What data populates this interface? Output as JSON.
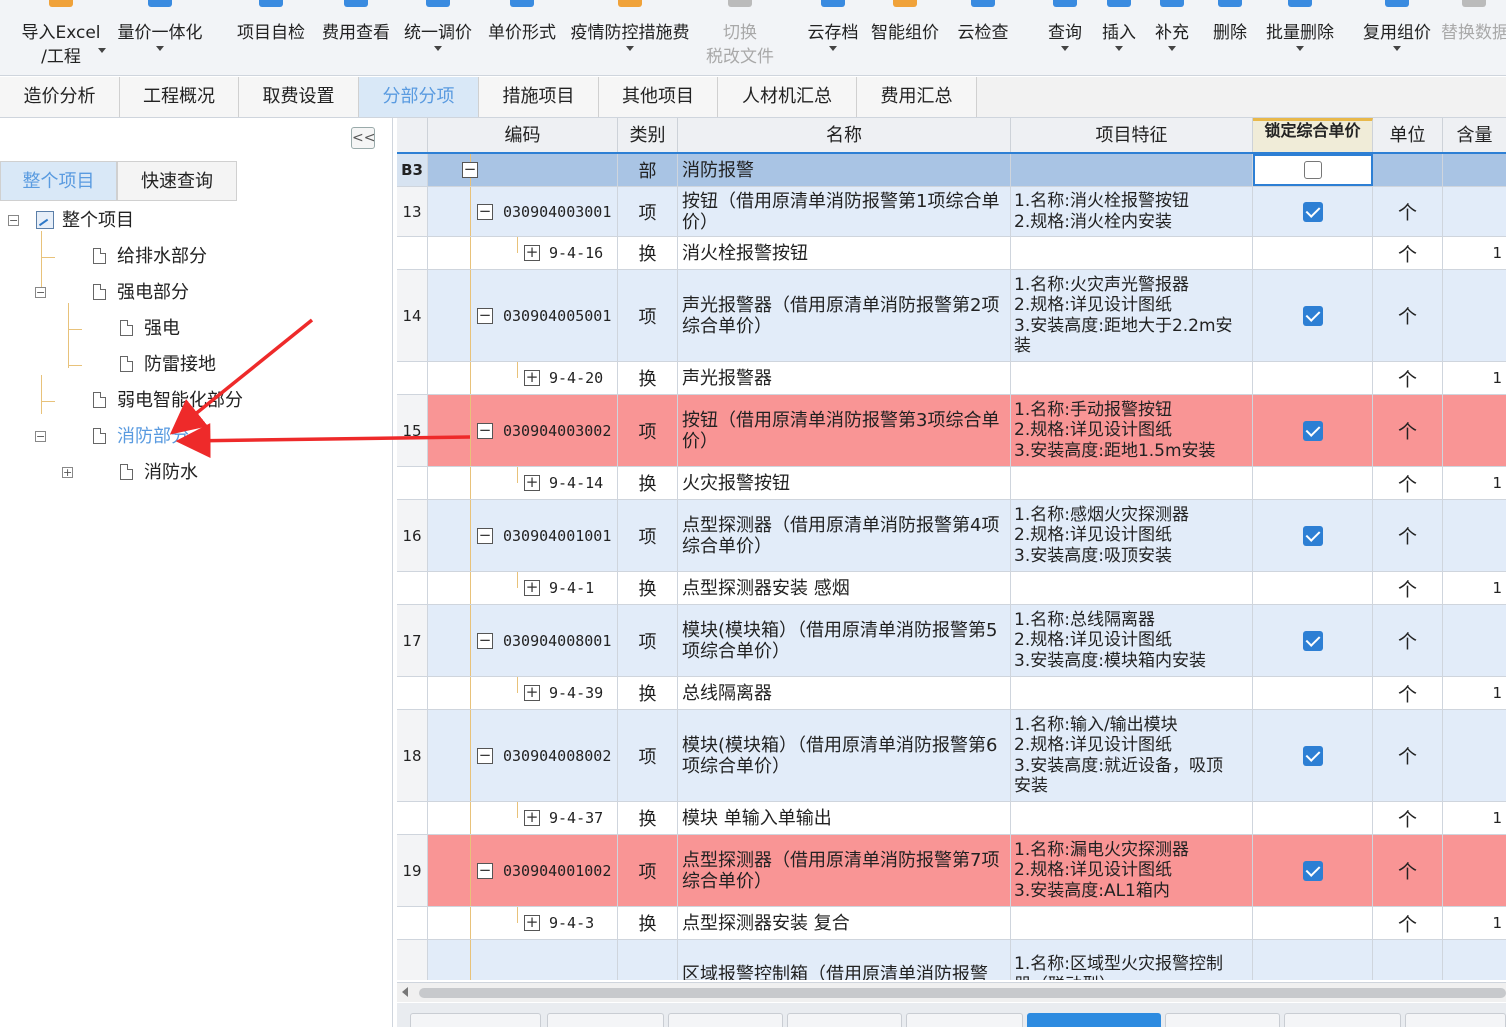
{
  "toolbar": {
    "buttons": [
      {
        "label": "导入Excel",
        "label2": "/工程",
        "icon_color": "#f0a23a",
        "caret": true,
        "disabled": false
      },
      {
        "label": "量价一体化",
        "label2": "",
        "icon_color": "#3a8be0",
        "caret": true,
        "disabled": false
      },
      {
        "label": "项目自检",
        "label2": "",
        "icon_color": "#3a8be0",
        "caret": false,
        "disabled": false
      },
      {
        "label": "费用查看",
        "label2": "",
        "icon_color": "#3a8be0",
        "caret": false,
        "disabled": false
      },
      {
        "label": "统一调价",
        "label2": "",
        "icon_color": "#3a8be0",
        "caret": true,
        "disabled": false
      },
      {
        "label": "单价形式",
        "label2": "",
        "icon_color": "#3a8be0",
        "caret": false,
        "disabled": false
      },
      {
        "label": "疫情防控措施费",
        "label2": "",
        "icon_color": "#f0a23a",
        "caret": true,
        "disabled": false
      },
      {
        "label": "切换",
        "label2": "税改文件",
        "icon_color": "#bbbbbb",
        "caret": false,
        "disabled": true
      },
      {
        "label": "云存档",
        "label2": "",
        "icon_color": "#3a8be0",
        "caret": true,
        "disabled": false
      },
      {
        "label": "智能组价",
        "label2": "",
        "icon_color": "#f0a23a",
        "caret": false,
        "disabled": false
      },
      {
        "label": "云检查",
        "label2": "",
        "icon_color": "#3a8be0",
        "caret": false,
        "disabled": false
      },
      {
        "label": "查询",
        "label2": "",
        "icon_color": "#3a8be0",
        "caret": true,
        "disabled": false
      },
      {
        "label": "插入",
        "label2": "",
        "icon_color": "#3a8be0",
        "caret": true,
        "disabled": false
      },
      {
        "label": "补充",
        "label2": "",
        "icon_color": "#3a8be0",
        "caret": true,
        "disabled": false
      },
      {
        "label": "删除",
        "label2": "",
        "icon_color": "#3a8be0",
        "caret": false,
        "disabled": false
      },
      {
        "label": "批量删除",
        "label2": "",
        "icon_color": "#3a8be0",
        "caret": true,
        "disabled": false
      },
      {
        "label": "复用组价",
        "label2": "",
        "icon_color": "#3a8be0",
        "caret": true,
        "disabled": false
      },
      {
        "label": "替换数据",
        "label2": "",
        "icon_color": "#bbbbbb",
        "caret": false,
        "disabled": true
      }
    ]
  },
  "main_tabs": [
    {
      "label": "造价分析",
      "active": false
    },
    {
      "label": "工程概况",
      "active": false
    },
    {
      "label": "取费设置",
      "active": false
    },
    {
      "label": "分部分项",
      "active": true
    },
    {
      "label": "措施项目",
      "active": false
    },
    {
      "label": "其他项目",
      "active": false
    },
    {
      "label": "人材机汇总",
      "active": false
    },
    {
      "label": "费用汇总",
      "active": false
    }
  ],
  "left_panel": {
    "collapse_label": "<<",
    "tabs": [
      {
        "label": "整个项目",
        "active": true
      },
      {
        "label": "快速查询",
        "active": false
      }
    ],
    "tree": [
      {
        "label": "整个项目",
        "level": 0,
        "toggle": "minus",
        "root": true,
        "selected": false
      },
      {
        "label": "给排水部分",
        "level": 1,
        "toggle": "",
        "root": false,
        "selected": false
      },
      {
        "label": "强电部分",
        "level": 1,
        "toggle": "minus",
        "root": false,
        "selected": false
      },
      {
        "label": "强电",
        "level": 2,
        "toggle": "",
        "root": false,
        "selected": false
      },
      {
        "label": "防雷接地",
        "level": 2,
        "toggle": "",
        "root": false,
        "selected": false
      },
      {
        "label": "弱电智能化部分",
        "level": 1,
        "toggle": "",
        "root": false,
        "selected": false
      },
      {
        "label": "消防部分",
        "level": 1,
        "toggle": "minus",
        "root": false,
        "selected": true
      },
      {
        "label": "消防水",
        "level": 2,
        "toggle": "plus",
        "root": false,
        "selected": false
      }
    ]
  },
  "grid": {
    "columns": {
      "code": "编码",
      "type": "类别",
      "name": "名称",
      "feature": "项目特征",
      "lock": "锁定综合单价",
      "unit": "单位",
      "qty": "含量"
    },
    "rows": [
      {
        "kind": "head",
        "rownum": "B3",
        "code": "",
        "type": "部",
        "name": [
          "消防报警"
        ],
        "feature": [],
        "lock": "off",
        "unit": "",
        "qty": ""
      },
      {
        "kind": "xiang",
        "rownum": "13",
        "code": "030904003001",
        "type": "项",
        "name": [
          "按钮（借用原清单消防报警第1项综合单",
          "价）"
        ],
        "feature": [
          "1.名称:消火栓报警按钮",
          "2.规格:消火栓内安装"
        ],
        "lock": "on",
        "unit": "个",
        "qty": ""
      },
      {
        "kind": "huan",
        "rownum": "",
        "code": "9-4-16",
        "type": "换",
        "name": [
          "消火栓报警按钮"
        ],
        "feature": [],
        "lock": "",
        "unit": "个",
        "qty": "1"
      },
      {
        "kind": "xiang",
        "rownum": "14",
        "code": "030904005001",
        "type": "项",
        "name": [
          "声光报警器（借用原清单消防报警第2项",
          "综合单价）"
        ],
        "feature": [
          "1.名称:火灾声光警报器",
          "2.规格:详见设计图纸",
          "3.安装高度:距地大于2.2m安",
          "装"
        ],
        "lock": "on",
        "unit": "个",
        "qty": ""
      },
      {
        "kind": "huan",
        "rownum": "",
        "code": "9-4-20",
        "type": "换",
        "name": [
          "声光报警器"
        ],
        "feature": [],
        "lock": "",
        "unit": "个",
        "qty": "1"
      },
      {
        "kind": "red",
        "rownum": "15",
        "code": "030904003002",
        "type": "项",
        "name": [
          "按钮（借用原清单消防报警第3项综合单",
          "价）"
        ],
        "feature": [
          "1.名称:手动报警按钮",
          "2.规格:详见设计图纸",
          "3.安装高度:距地1.5m安装"
        ],
        "lock": "on",
        "unit": "个",
        "qty": ""
      },
      {
        "kind": "huan",
        "rownum": "",
        "code": "9-4-14",
        "type": "换",
        "name": [
          "火灾报警按钮"
        ],
        "feature": [],
        "lock": "",
        "unit": "个",
        "qty": "1"
      },
      {
        "kind": "xiang",
        "rownum": "16",
        "code": "030904001001",
        "type": "项",
        "name": [
          "点型探测器（借用原清单消防报警第4项",
          "综合单价）"
        ],
        "feature": [
          "1.名称:感烟火灾探测器",
          "2.规格:详见设计图纸",
          "3.安装高度:吸顶安装"
        ],
        "lock": "on",
        "unit": "个",
        "qty": ""
      },
      {
        "kind": "huan",
        "rownum": "",
        "code": "9-4-1",
        "type": "换",
        "name": [
          "点型探测器安装 感烟"
        ],
        "feature": [],
        "lock": "",
        "unit": "个",
        "qty": "1"
      },
      {
        "kind": "xiang",
        "rownum": "17",
        "code": "030904008001",
        "type": "项",
        "name": [
          "模块(模块箱）（借用原清单消防报警第5",
          "项综合单价）"
        ],
        "feature": [
          "1.名称:总线隔离器",
          "2.规格:详见设计图纸",
          "3.安装高度:模块箱内安装"
        ],
        "lock": "on",
        "unit": "个",
        "qty": ""
      },
      {
        "kind": "huan",
        "rownum": "",
        "code": "9-4-39",
        "type": "换",
        "name": [
          "总线隔离器"
        ],
        "feature": [],
        "lock": "",
        "unit": "个",
        "qty": "1"
      },
      {
        "kind": "xiang",
        "rownum": "18",
        "code": "030904008002",
        "type": "项",
        "name": [
          "模块(模块箱）（借用原清单消防报警第6",
          "项综合单价）"
        ],
        "feature": [
          "1.名称:输入/输出模块",
          "2.规格:详见设计图纸",
          "3.安装高度:就近设备，吸顶",
          "安装"
        ],
        "lock": "on",
        "unit": "个",
        "qty": ""
      },
      {
        "kind": "huan",
        "rownum": "",
        "code": "9-4-37",
        "type": "换",
        "name": [
          "模块 单输入单输出"
        ],
        "feature": [],
        "lock": "",
        "unit": "个",
        "qty": "1"
      },
      {
        "kind": "red",
        "rownum": "19",
        "code": "030904001002",
        "type": "项",
        "name": [
          "点型探测器（借用原清单消防报警第7项",
          "综合单价）"
        ],
        "feature": [
          "1.名称:漏电火灾探测器",
          "2.规格:详见设计图纸",
          "3.安装高度:AL1箱内"
        ],
        "lock": "on",
        "unit": "个",
        "qty": ""
      },
      {
        "kind": "huan",
        "rownum": "",
        "code": "9-4-3",
        "type": "换",
        "name": [
          "点型探测器安装 复合"
        ],
        "feature": [],
        "lock": "",
        "unit": "个",
        "qty": "1"
      },
      {
        "kind": "xiang",
        "rownum": "",
        "code": "",
        "type": "",
        "name": [
          "",
          "区域报警控制箱（借用原清单消防报警"
        ],
        "feature": [
          "1.名称:区域型火灾报警控制",
          "器（联动型）"
        ],
        "lock": "",
        "unit": "",
        "qty": ""
      }
    ]
  },
  "colors": {
    "accent": "#5a9be0",
    "row_head": "#a9c4e4",
    "row_item": "#e2ecf9",
    "row_red": "#f99595",
    "checkbox": "#2d7fd4",
    "annotation_arrow": "#ee2a2a"
  }
}
